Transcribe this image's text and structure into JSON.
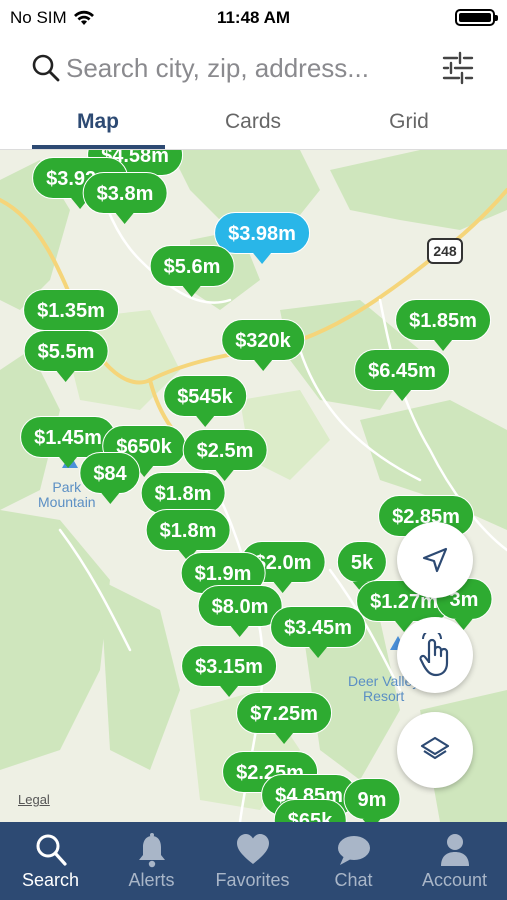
{
  "status_bar": {
    "carrier": "No SIM",
    "time": "11:48 AM"
  },
  "search": {
    "placeholder": "Search city, zip, address..."
  },
  "tabs": [
    {
      "label": "Map",
      "active": true
    },
    {
      "label": "Cards",
      "active": false
    },
    {
      "label": "Grid",
      "active": false
    }
  ],
  "map": {
    "road_shield": "248",
    "place_labels": {
      "park_mountain": "Park\nMountain",
      "deer_valley": "Deer Valley\nResort"
    },
    "legal": "Legal",
    "pins": [
      {
        "label": "$4.58m",
        "color": "green"
      },
      {
        "label": "$3.92m",
        "color": "green"
      },
      {
        "label": "$3.8m",
        "color": "green"
      },
      {
        "label": "$3.98m",
        "color": "blue"
      },
      {
        "label": "$5.6m",
        "color": "green"
      },
      {
        "label": "$1.85m",
        "color": "green"
      },
      {
        "label": "$1.35m",
        "color": "green"
      },
      {
        "label": "$5.5m",
        "color": "green"
      },
      {
        "label": "$320k",
        "color": "green"
      },
      {
        "label": "$6.45m",
        "color": "green"
      },
      {
        "label": "$545k",
        "color": "green"
      },
      {
        "label": "$1.45m",
        "color": "green"
      },
      {
        "label": "$650k",
        "color": "green"
      },
      {
        "label": "$2.5m",
        "color": "green"
      },
      {
        "label": "$84",
        "color": "green"
      },
      {
        "label": "$1.8m",
        "color": "green"
      },
      {
        "label": "$1.8m",
        "color": "green"
      },
      {
        "label": "$2.85m",
        "color": "green"
      },
      {
        "label": "$2.0m",
        "color": "green"
      },
      {
        "label": "$1.9m",
        "color": "green"
      },
      {
        "label": "5k",
        "color": "green"
      },
      {
        "label": "$1.27m",
        "color": "green"
      },
      {
        "label": "3m",
        "color": "green"
      },
      {
        "label": "$8.0m",
        "color": "green"
      },
      {
        "label": "$3.45m",
        "color": "green"
      },
      {
        "label": "$3.15m",
        "color": "green"
      },
      {
        "label": "$7.25m",
        "color": "green"
      },
      {
        "label": "$2.25m",
        "color": "green"
      },
      {
        "label": "$4.85m",
        "color": "green"
      },
      {
        "label": "9m",
        "color": "green"
      },
      {
        "label": "$65k",
        "color": "green"
      }
    ]
  },
  "fabs": {
    "locate": "location-arrow-icon",
    "draw": "hand-draw-icon",
    "layers": "layers-icon"
  },
  "bottom_nav": [
    {
      "label": "Search",
      "icon": "search-icon",
      "active": true
    },
    {
      "label": "Alerts",
      "icon": "bell-icon",
      "active": false
    },
    {
      "label": "Favorites",
      "icon": "heart-icon",
      "active": false
    },
    {
      "label": "Chat",
      "icon": "chat-icon",
      "active": false
    },
    {
      "label": "Account",
      "icon": "person-icon",
      "active": false
    }
  ],
  "colors": {
    "brand_navy": "#2d4a73",
    "pin_green": "#2eab31",
    "pin_blue": "#29b6e8"
  }
}
